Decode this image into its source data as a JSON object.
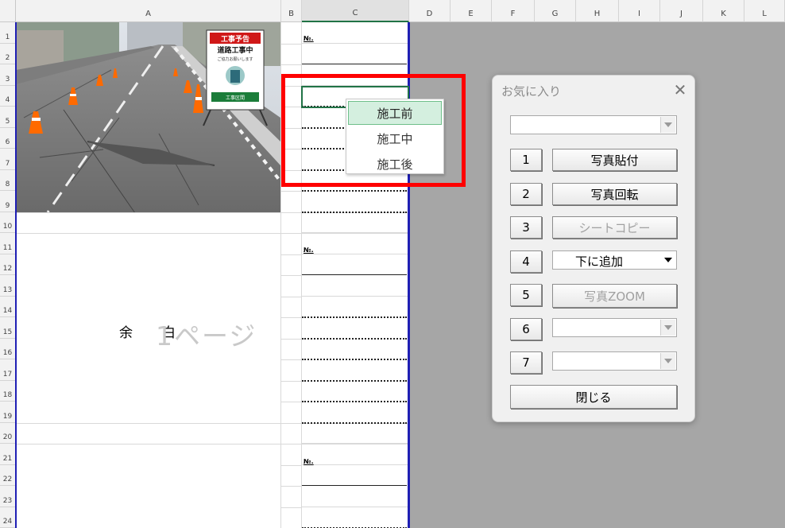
{
  "columns": [
    "A",
    "B",
    "C",
    "D",
    "E",
    "F",
    "G",
    "H",
    "I",
    "J",
    "K",
    "L"
  ],
  "rows": [
    "1",
    "2",
    "3",
    "4",
    "5",
    "6",
    "7",
    "8",
    "9",
    "10",
    "11",
    "12",
    "13",
    "14",
    "15",
    "16",
    "17",
    "18",
    "19",
    "20",
    "21",
    "22",
    "23",
    "24"
  ],
  "sheet": {
    "no_label": "№.",
    "yohaku_1": "余",
    "yohaku_2": "白",
    "page_watermark": "1ページ",
    "photo": {
      "sign_title": "工事予告",
      "sign_main": "道路工事中",
      "sign_sub": "ご協力お願いします",
      "sign_period": "工事区間"
    }
  },
  "cell_dropdown": {
    "items": [
      "施工前",
      "施工中",
      "施工後"
    ],
    "selected_index": 0
  },
  "dialog": {
    "title": "お気に入り",
    "top_combo_value": "",
    "rows": [
      {
        "num": "1",
        "label": "写真貼付",
        "kind": "button",
        "enabled": true
      },
      {
        "num": "2",
        "label": "写真回転",
        "kind": "button",
        "enabled": true
      },
      {
        "num": "3",
        "label": "シートコピー",
        "kind": "button",
        "enabled": false
      },
      {
        "num": "4",
        "label": "下に追加",
        "kind": "combo",
        "enabled": true
      },
      {
        "num": "5",
        "label": "写真ZOOM",
        "kind": "button",
        "enabled": false
      },
      {
        "num": "6",
        "label": "",
        "kind": "combo",
        "enabled": false
      },
      {
        "num": "7",
        "label": "",
        "kind": "combo",
        "enabled": false
      }
    ],
    "close_label": "閉じる"
  },
  "colors": {
    "highlight": "#ff0000",
    "active_cell": "#217346",
    "page_break": "#1f1fb4",
    "list_selected": "#d4efdf"
  }
}
